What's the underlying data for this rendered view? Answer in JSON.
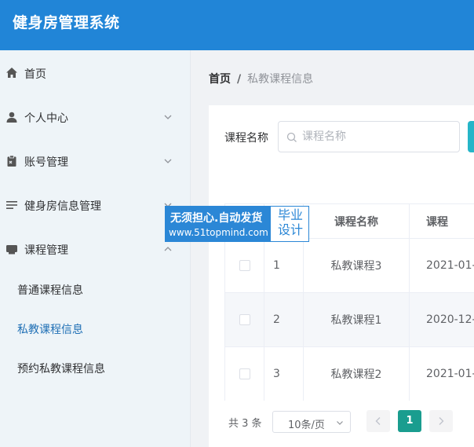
{
  "app": {
    "title": "健身房管理系统"
  },
  "sidebar": {
    "items": [
      {
        "label": "首页",
        "icon": "home-icon"
      },
      {
        "label": "个人中心",
        "icon": "user-icon"
      },
      {
        "label": "账号管理",
        "icon": "clipboard-icon"
      },
      {
        "label": "健身房信息管理",
        "icon": "list-icon"
      },
      {
        "label": "课程管理",
        "icon": "folder-icon"
      }
    ],
    "subitems": [
      {
        "label": "普通课程信息"
      },
      {
        "label": "私教课程信息"
      },
      {
        "label": "预约私教课程信息"
      }
    ]
  },
  "breadcrumb": {
    "home": "首页",
    "separator": "/",
    "current": "私教课程信息"
  },
  "search": {
    "label": "课程名称",
    "placeholder": "课程名称"
  },
  "table": {
    "headers": [
      "",
      "",
      "课程名称",
      "课程"
    ],
    "rows": [
      {
        "index": "1",
        "name": "私教课程3",
        "date": "2021-01-"
      },
      {
        "index": "2",
        "name": "私教课程1",
        "date": "2020-12-"
      },
      {
        "index": "3",
        "name": "私教课程2",
        "date": "2021-01-"
      }
    ]
  },
  "watermark": {
    "line1": "无须担心.自动发货",
    "line2": "www.51topmind.com",
    "tag": "毕业设计"
  },
  "pagination": {
    "total": "共 3 条",
    "page_size": "10条/页",
    "current_page": "1"
  },
  "colors": {
    "header": "#2185d7",
    "accent": "#1a9d8f",
    "active_menu": "#1f6fb5",
    "search_button": "#26b5c8"
  }
}
